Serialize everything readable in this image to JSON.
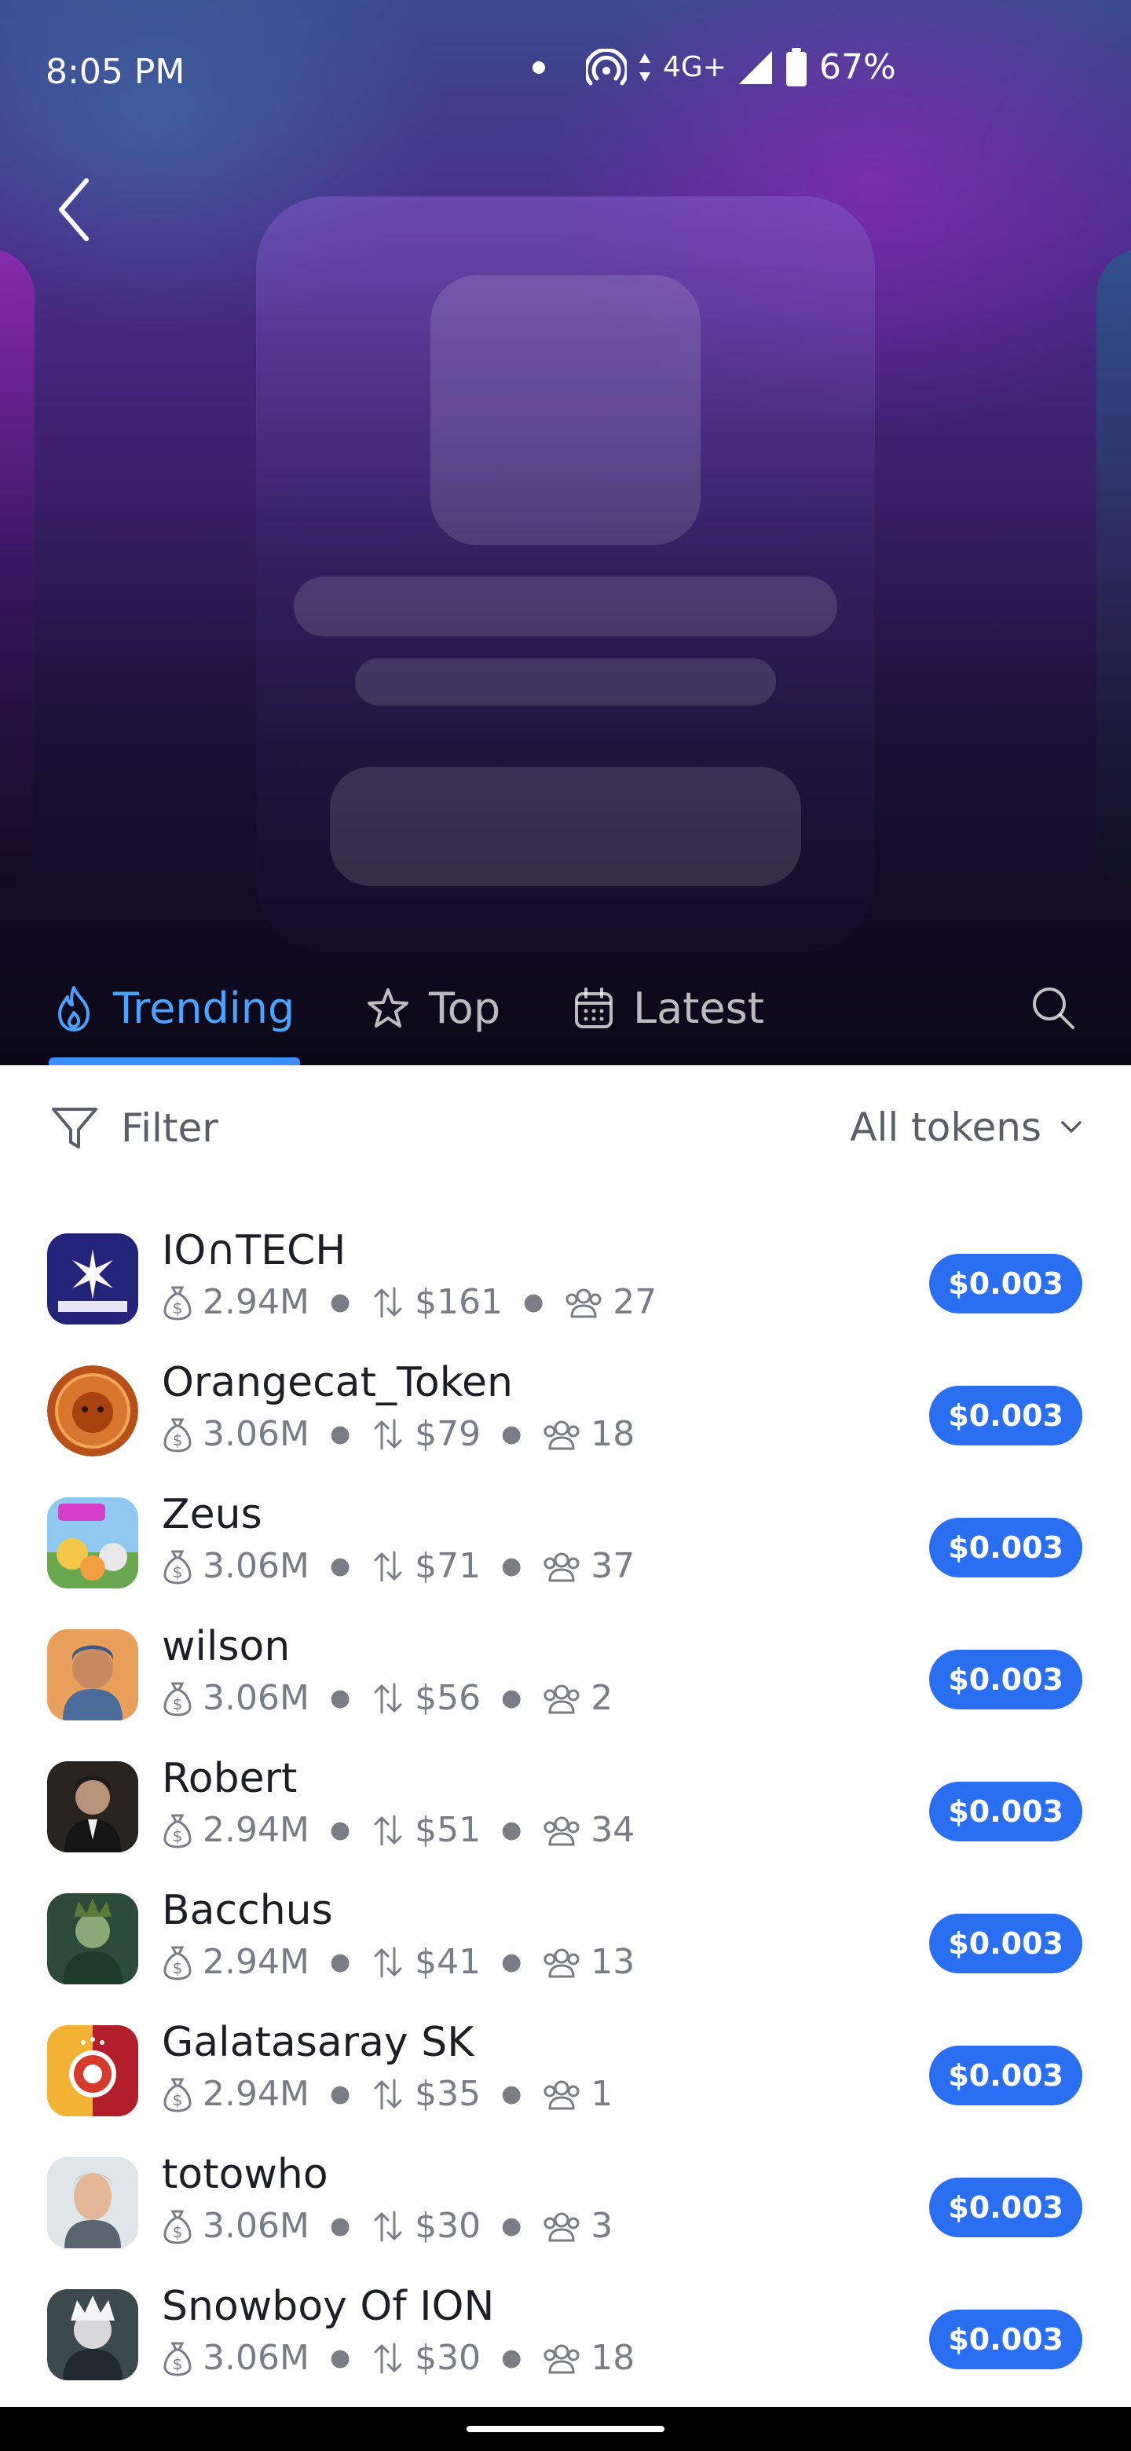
{
  "status_bar": {
    "time": "8:05 PM",
    "network": "4G+",
    "battery": "67%"
  },
  "tabs": [
    {
      "label": "Trending",
      "icon": "flame-icon",
      "active": true
    },
    {
      "label": "Top",
      "icon": "star-icon",
      "active": false
    },
    {
      "label": "Latest",
      "icon": "calendar-icon",
      "active": false
    }
  ],
  "filter": {
    "label": "Filter",
    "scope": "All tokens"
  },
  "tokens": [
    {
      "name": "IO∩TECH",
      "market_cap": "2.94M",
      "volume": "$161",
      "holders": "27",
      "price": "$0.003"
    },
    {
      "name": "Orangecat_Token",
      "market_cap": "3.06M",
      "volume": "$79",
      "holders": "18",
      "price": "$0.003"
    },
    {
      "name": "Zeus",
      "market_cap": "3.06M",
      "volume": "$71",
      "holders": "37",
      "price": "$0.003"
    },
    {
      "name": "wilson",
      "market_cap": "3.06M",
      "volume": "$56",
      "holders": "2",
      "price": "$0.003"
    },
    {
      "name": "Robert",
      "market_cap": "2.94M",
      "volume": "$51",
      "holders": "34",
      "price": "$0.003"
    },
    {
      "name": "Bacchus",
      "market_cap": "2.94M",
      "volume": "$41",
      "holders": "13",
      "price": "$0.003"
    },
    {
      "name": "Galatasaray SK",
      "market_cap": "2.94M",
      "volume": "$35",
      "holders": "1",
      "price": "$0.003"
    },
    {
      "name": "totowho",
      "market_cap": "3.06M",
      "volume": "$30",
      "holders": "3",
      "price": "$0.003"
    },
    {
      "name": "Snowboy Of ION",
      "market_cap": "3.06M",
      "volume": "$30",
      "holders": "18",
      "price": "$0.003"
    }
  ],
  "colors": {
    "accent": "#2a6ef2",
    "active_tab": "#4aa3ff",
    "muted_text": "#7a7d86"
  }
}
